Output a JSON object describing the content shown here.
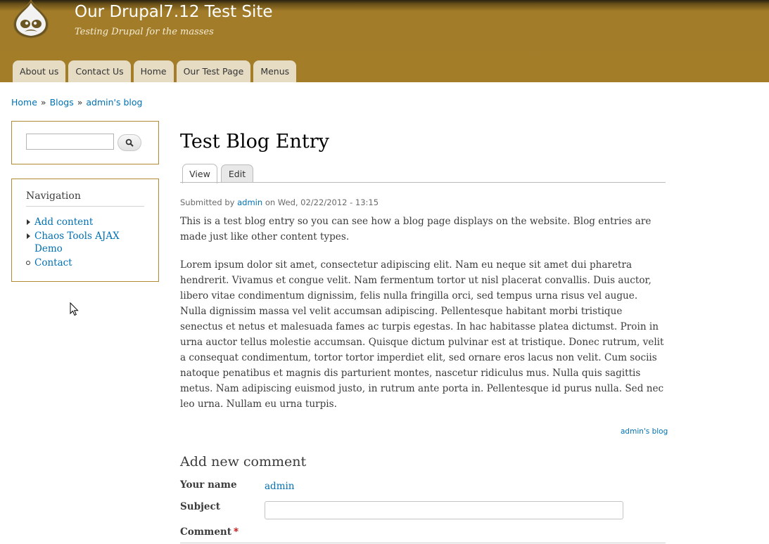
{
  "header": {
    "site_name": "Our Drupal7.12 Test Site",
    "slogan": "Testing Drupal for the masses",
    "logo_icon": "drupal-drop-logo-icon",
    "background_color": "#a37d27",
    "menu": [
      {
        "label": "About us"
      },
      {
        "label": "Contact Us"
      },
      {
        "label": "Home"
      },
      {
        "label": "Our Test Page"
      },
      {
        "label": "Menus"
      }
    ]
  },
  "breadcrumb": {
    "items": [
      "Home",
      "Blogs",
      "admin's blog"
    ],
    "separator": "»"
  },
  "sidebar": {
    "search": {
      "icon": "search-icon",
      "value": ""
    },
    "navigation": {
      "title": "Navigation",
      "items": [
        {
          "label": "Add content",
          "bullet": "triangle"
        },
        {
          "label": "Chaos Tools AJAX Demo",
          "bullet": "triangle"
        },
        {
          "label": "Contact",
          "bullet": "circle"
        }
      ]
    }
  },
  "main": {
    "title": "Test Blog Entry",
    "tabs": [
      {
        "label": "View"
      },
      {
        "label": "Edit"
      }
    ],
    "submitted": {
      "prefix": "Submitted by",
      "author": "admin",
      "date": "on Wed, 02/22/2012 - 13:15"
    },
    "paragraphs": [
      "This is a test blog entry so you can see how a blog page displays on the website. Blog entries are made just like other content types.",
      "Lorem ipsum dolor sit amet, consectetur adipiscing elit. Nam eu neque sit amet dui pharetra hendrerit. Vivamus et congue velit. Nam fermentum tortor ut nisl placerat convallis. Duis auctor, libero vitae condimentum dignissim, felis nulla fringilla orci, sed tempus urna risus vel augue. Nulla dignissim massa vel velit accumsan adipiscing. Pellentesque habitant morbi tristique senectus et netus et malesuada fames ac turpis egestas. In hac habitasse platea dictumst. Proin in urna auctor tellus molestie accumsan. Quisque dictum pulvinar est at tristique. Donec rutrum, velit a consequat condimentum, tortor tortor imperdiet elit, sed ornare eros lacus non velit. Cum sociis natoque penatibus et magnis dis parturient montes, nascetur ridiculus mus. Nulla quis sagittis metus. Nam adipiscing euismod justo, in rutrum ante porta in. Pellentesque id purus nulla. Sed nec leo urna. Nullam eu urna turpis."
    ],
    "blog_link": "admin's blog"
  },
  "comment_form": {
    "heading": "Add new comment",
    "name_label": "Your name",
    "name_value": "admin",
    "subject_label": "Subject",
    "subject_value": "",
    "comment_label": "Comment",
    "required_marker": "*"
  },
  "colors": {
    "link": "#0071b3",
    "block_border": "#b08a35",
    "menu_tab": "#e6dcc4"
  }
}
